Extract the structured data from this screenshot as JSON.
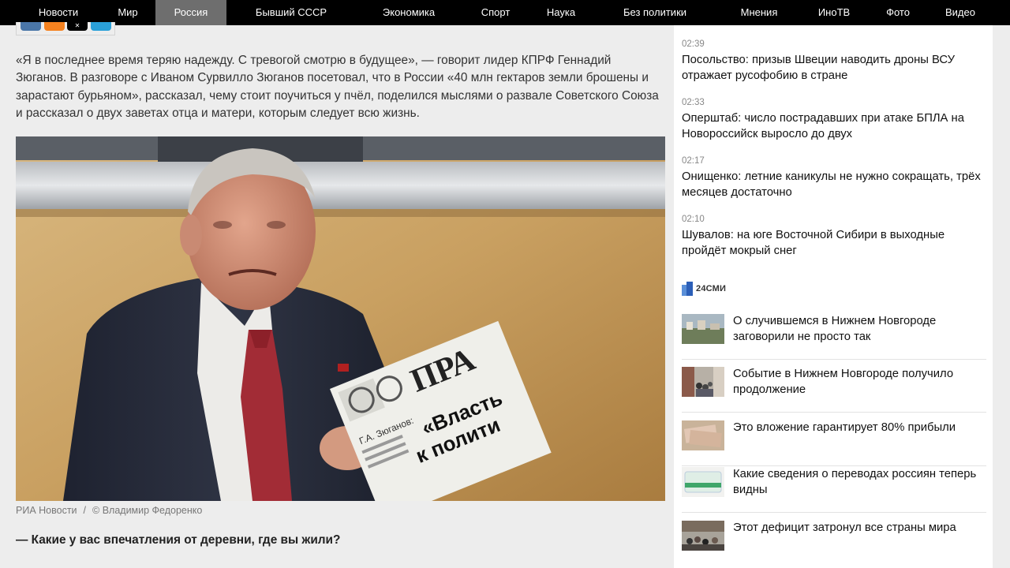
{
  "nav": {
    "items": [
      {
        "label": "Новости"
      },
      {
        "label": "Мир"
      },
      {
        "label": "Россия",
        "active": true
      },
      {
        "label": "Бывший СССР"
      },
      {
        "label": "Экономика"
      },
      {
        "label": "Спорт"
      },
      {
        "label": "Наука"
      },
      {
        "label": "Без политики"
      },
      {
        "label": "Мнения"
      },
      {
        "label": "ИноТВ"
      },
      {
        "label": "Фото"
      },
      {
        "label": "Видео"
      }
    ],
    "active_color": "#6e6e6e"
  },
  "share": {
    "buttons": [
      {
        "icon": "vk-icon",
        "color": "#4a76a8"
      },
      {
        "icon": "odnoklassniki-icon",
        "color": "#f58220"
      },
      {
        "icon": "x-icon",
        "color": "#000000"
      },
      {
        "icon": "telegram-icon",
        "color": "#2aa0d8"
      }
    ]
  },
  "article": {
    "lead": "«Я в последнее время теряю надежду. С тревогой смотрю в будущее», — говорит лидер КПРФ Геннадий Зюганов. В разговоре с Иваном Сурвилло Зюганов посетовал, что в России «40 млн гектаров земли брошены и зарастают бурьяном», рассказал, чему стоит поучиться у пчёл, поделился мыслями о развале Советского Союза и рассказал о двух заветах отца и матери, которым следует всю жизнь.",
    "photo": {
      "newspaper_text_1": "«Власть",
      "newspaper_text_2": "к полити",
      "newspaper_byline": "Г.А. Зюганов:",
      "newspaper_masthead": "ПРА"
    },
    "caption_source": "РИА Новости",
    "caption_sep": "/",
    "caption_author": "© Владимир Федоренко",
    "question": "— Какие у вас впечатления от деревни, где вы жили?"
  },
  "sidebar": {
    "news": [
      {
        "time": "02:39",
        "title": "Посольство: призыв Швеции наводить дроны ВСУ отражает русофобию в стране"
      },
      {
        "time": "02:33",
        "title": "Оперштаб: число пострадавших при атаке БПЛА на Новороссийск выросло до двух"
      },
      {
        "time": "02:17",
        "title": "Онищенко: летние каникулы не нужно сокращать, трёх месяцев достаточно"
      },
      {
        "time": "02:10",
        "title": "Шувалов: на юге Восточной Сибири в выходные пройдёт мокрый снег"
      }
    ],
    "partner_logo": "24СМИ",
    "promos": [
      {
        "text": "О случившемся в Нижнем Новгороде заговорили не просто так",
        "thumb": "city-river"
      },
      {
        "text": "Событие в Нижнем Новгороде получило продолжение",
        "thumb": "street-crowd"
      },
      {
        "text": "Это вложение гарантирует 80% прибыли",
        "thumb": "banknotes"
      },
      {
        "text": "Какие сведения о переводах россиян теперь видны",
        "thumb": "bank-card"
      },
      {
        "text": "Этот дефицит затронул все страны мира",
        "thumb": "city-crowd"
      }
    ]
  }
}
